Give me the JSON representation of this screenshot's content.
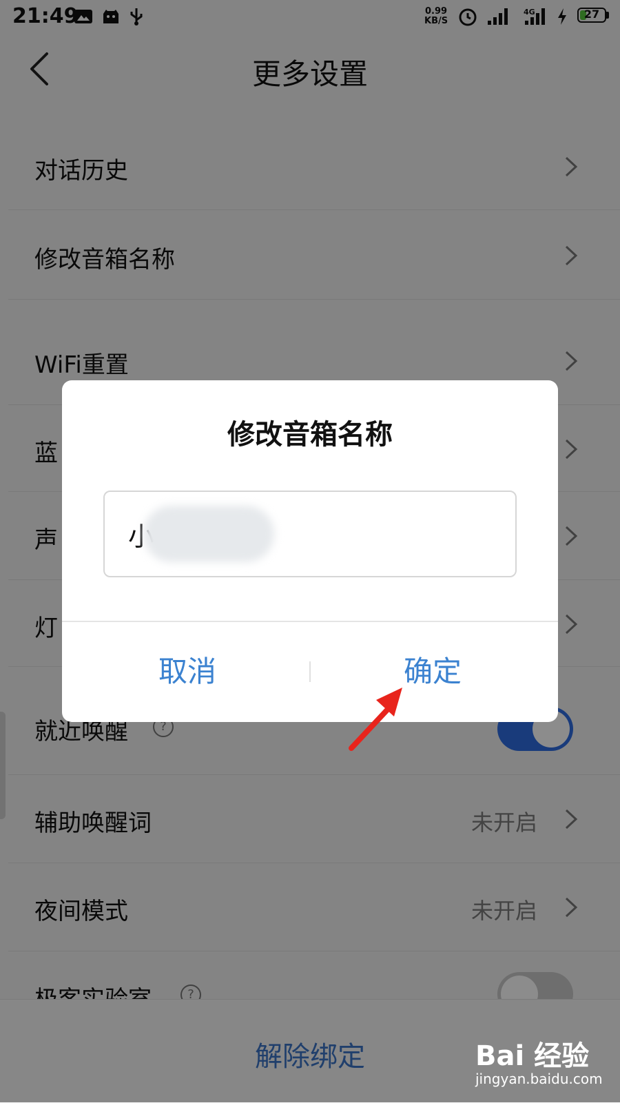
{
  "status_bar": {
    "time": "21:49",
    "net_speed_value": "0.99",
    "net_speed_unit": "KB/S",
    "signal_2_label": "4G",
    "battery": "27",
    "battery_level": 0.27,
    "battery_color": "#57c53c"
  },
  "header": {
    "title": "更多设置"
  },
  "settings": {
    "chat_history": "对话历史",
    "rename_speaker": "修改音箱名称",
    "wifi_reset": "WiFi重置",
    "bluetooth": "蓝",
    "sound": "声",
    "light": "灯",
    "nearby_wake": "就近唤醒",
    "aux_wake_word": {
      "label": "辅助唤醒词",
      "value": "未开启"
    },
    "night_mode": {
      "label": "夜间模式",
      "value": "未开启"
    },
    "geek_lab": "极客实验室",
    "help_glyph": "?",
    "nearby_wake_on": true,
    "geek_lab_on": false,
    "toggle_on_color": "#2f6ce0",
    "toggle_off_color": "#c8c8c8"
  },
  "unbind_label": "解除绑定",
  "dialog": {
    "title": "修改音箱名称",
    "input_value": "小",
    "cancel": "取消",
    "confirm": "确定",
    "button_color": "#3b82d0"
  },
  "watermark": {
    "logo": "Bai 经验",
    "url": "jingyan.baidu.com"
  },
  "icons": [
    "back-icon",
    "gallery-icon",
    "android-icon",
    "usb-icon",
    "alarm-icon",
    "signal-icon",
    "charging-icon",
    "chevron-right-icon",
    "help-icon",
    "annotation-arrow-icon"
  ]
}
